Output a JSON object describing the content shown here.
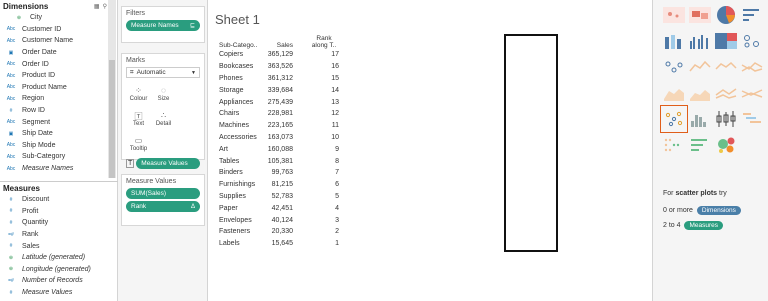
{
  "sidebar": {
    "dimensions_title": "Dimensions",
    "dimensions": [
      {
        "type": "⊕",
        "name": "City",
        "italic": false,
        "geo": true
      },
      {
        "type": "Abc",
        "name": "Customer ID"
      },
      {
        "type": "Abc",
        "name": "Customer Name"
      },
      {
        "type": "▣",
        "name": "Order Date"
      },
      {
        "type": "Abc",
        "name": "Order ID"
      },
      {
        "type": "Abc",
        "name": "Product ID"
      },
      {
        "type": "Abc",
        "name": "Product Name"
      },
      {
        "type": "Abc",
        "name": "Region"
      },
      {
        "type": "#",
        "name": "Row ID"
      },
      {
        "type": "Abc",
        "name": "Segment"
      },
      {
        "type": "▣",
        "name": "Ship Date"
      },
      {
        "type": "Abc",
        "name": "Ship Mode"
      },
      {
        "type": "Abc",
        "name": "Sub-Category"
      },
      {
        "type": "Abc",
        "name": "Measure Names",
        "italic": true
      }
    ],
    "measures_title": "Measures",
    "measures": [
      {
        "type": "#",
        "name": "Discount"
      },
      {
        "type": "#",
        "name": "Profit"
      },
      {
        "type": "#",
        "name": "Quantity"
      },
      {
        "type": "=#",
        "name": "Rank"
      },
      {
        "type": "#",
        "name": "Sales"
      },
      {
        "type": "⊕",
        "name": "Latitude (generated)",
        "italic": true
      },
      {
        "type": "⊕",
        "name": "Longitude (generated)",
        "italic": true
      },
      {
        "type": "=#",
        "name": "Number of Records",
        "italic": true
      },
      {
        "type": "#",
        "name": "Measure Values",
        "italic": true
      }
    ]
  },
  "filters": {
    "title": "Filters",
    "pill": "Measure Names",
    "pill_icon": "⊑"
  },
  "marks": {
    "title": "Marks",
    "type_label": "Automatic",
    "buttons": [
      "Colour",
      "Size",
      "Text",
      "Detail",
      "Tooltip"
    ],
    "measure_pill": "Measure Values"
  },
  "measure_values": {
    "title": "Measure Values",
    "items": [
      {
        "label": "SUM(Sales)",
        "flag": ""
      },
      {
        "label": "Rank",
        "flag": "Δ"
      }
    ]
  },
  "sheet": {
    "title": "Sheet 1",
    "headers": [
      "Sub-Catego..",
      "Sales",
      "Rank",
      "along T.."
    ],
    "rows": [
      [
        "Copiers",
        "365,129",
        "17"
      ],
      [
        "Bookcases",
        "363,526",
        "16"
      ],
      [
        "Phones",
        "361,312",
        "15"
      ],
      [
        "Storage",
        "339,684",
        "14"
      ],
      [
        "Appliances",
        "275,439",
        "13"
      ],
      [
        "Chairs",
        "228,981",
        "12"
      ],
      [
        "Machines",
        "223,165",
        "11"
      ],
      [
        "Accessories",
        "163,073",
        "10"
      ],
      [
        "Art",
        "160,088",
        "9"
      ],
      [
        "Tables",
        "105,381",
        "8"
      ],
      [
        "Binders",
        "99,763",
        "7"
      ],
      [
        "Furnishings",
        "81,215",
        "6"
      ],
      [
        "Supplies",
        "52,783",
        "5"
      ],
      [
        "Paper",
        "42,451",
        "4"
      ],
      [
        "Envelopes",
        "40,124",
        "3"
      ],
      [
        "Fasteners",
        "20,330",
        "2"
      ],
      [
        "Labels",
        "15,645",
        "1"
      ]
    ]
  },
  "show_me": {
    "hint_prefix": "For",
    "hint_chart": "scatter plots",
    "hint_suffix": "try",
    "dims_prefix": "0 or more",
    "dims_label": "Dimensions",
    "meas_prefix": "2 to 4",
    "meas_label": "Measures"
  },
  "colors": {
    "accent": "#2a9d7f",
    "selected": "#e05e1a",
    "blue": "#4a7fa8"
  }
}
